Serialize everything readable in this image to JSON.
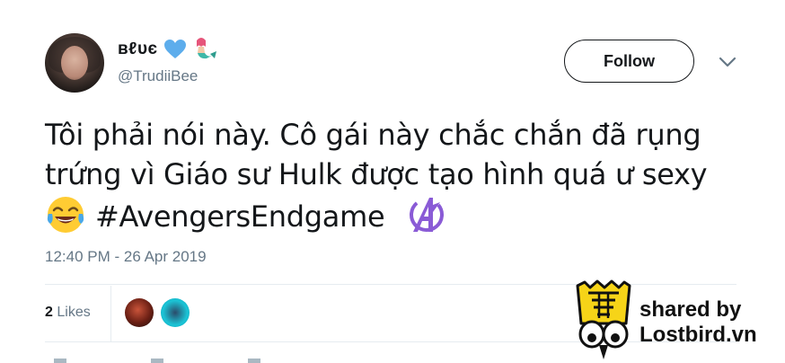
{
  "tweet": {
    "display_name": "ʙℓυє",
    "handle": "@TrudiiBee",
    "follow_label": "Follow",
    "text_line1": "Tôi phải nói này. Cô gái này chắc chắn đã rụng",
    "text_line2": "trứng vì Giáo sư Hulk được tạo hình quá ư sexy",
    "hashtag": "#AvengersEndgame",
    "timestamp": "12:40 PM - 26 Apr 2019",
    "likes_count": "2",
    "likes_label": "Likes"
  },
  "icons": {
    "heart": "blue-heart-icon",
    "mermaid": "mermaid-icon",
    "emoji": "face-with-tears-of-joy-icon",
    "avengers": "avengers-logo-icon",
    "chevron": "chevron-down-icon"
  },
  "watermark": {
    "line1": "shared by",
    "line2": "Lostbird.vn"
  },
  "colors": {
    "text": "#14171a",
    "secondary": "#657786",
    "heart": "#5dadec",
    "avengers": "#8a5bd6",
    "divider": "#e6ecf0"
  }
}
